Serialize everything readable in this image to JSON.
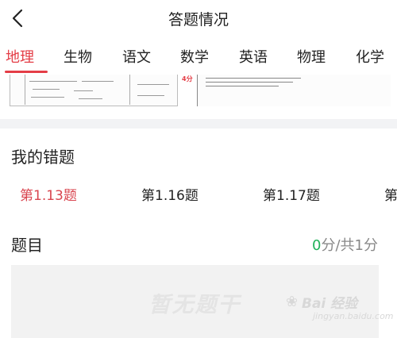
{
  "header": {
    "title": "答题情况"
  },
  "tabs": [
    {
      "label": "地理",
      "active": true
    },
    {
      "label": "生物",
      "active": false
    },
    {
      "label": "语文",
      "active": false
    },
    {
      "label": "数学",
      "active": false
    },
    {
      "label": "英语",
      "active": false
    },
    {
      "label": "物理",
      "active": false
    },
    {
      "label": "化学",
      "active": false
    }
  ],
  "paper_preview": {
    "score_mark": "4分"
  },
  "wrong_questions": {
    "title": "我的错题",
    "items": [
      {
        "label": "第1.13题",
        "active": true
      },
      {
        "label": "第1.16题",
        "active": false
      },
      {
        "label": "第1.17题",
        "active": false
      },
      {
        "label": "第",
        "active": false
      }
    ]
  },
  "question": {
    "label": "题目",
    "score_got": "0",
    "score_rest": "分/共1分",
    "empty_text": "暂无题干"
  },
  "watermark": {
    "main": "Bai 经验",
    "sub": "jingyan.baidu.com"
  },
  "colors": {
    "accent": "#e43d46",
    "score_green": "#21b25a",
    "band": "#f2f3f5"
  }
}
